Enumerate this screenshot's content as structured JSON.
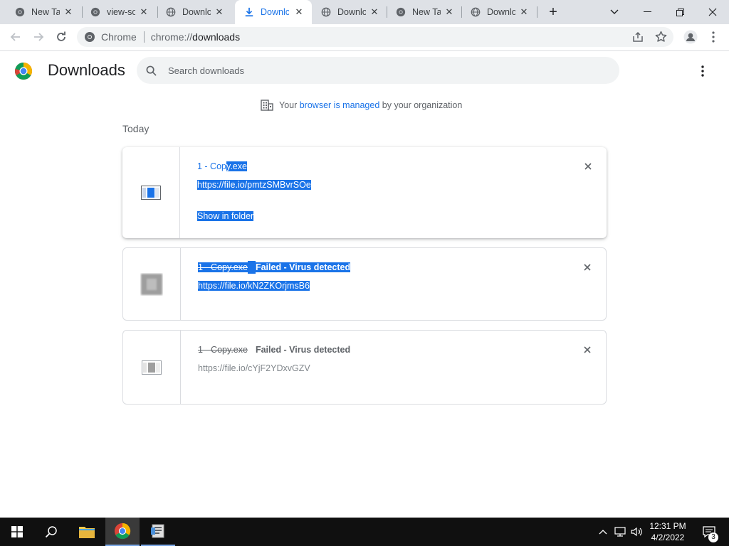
{
  "tabs": [
    {
      "title": "New Tab",
      "icon": "chrome-icon",
      "active": false
    },
    {
      "title": "view-source",
      "icon": "chrome-icon",
      "active": false
    },
    {
      "title": "Downloads",
      "icon": "globe-icon",
      "active": false
    },
    {
      "title": "Downloads",
      "icon": "download-icon",
      "active": true
    },
    {
      "title": "Downloads",
      "icon": "globe-icon",
      "active": false
    },
    {
      "title": "New Tab",
      "icon": "chrome-icon",
      "active": false
    },
    {
      "title": "Downloads",
      "icon": "globe-icon",
      "active": false
    }
  ],
  "omnibox": {
    "chip_label": "Chrome",
    "url_scheme": "chrome://",
    "url_path": "downloads"
  },
  "downloads_page": {
    "title": "Downloads",
    "search_placeholder": "Search downloads",
    "managed_prefix": "Your ",
    "managed_link": "browser is managed",
    "managed_suffix": " by your organization",
    "section_label": "Today"
  },
  "items": [
    {
      "name_a": "1 - Cop",
      "name_b": "y.exe",
      "url": "https://file.io/pmtzSMBvrSOe",
      "action": "Show in folder",
      "status": ""
    },
    {
      "name": "1 - Copy.exe",
      "url": "https://file.io/kN2ZKOrjmsB6",
      "status": "Failed - Virus detected"
    },
    {
      "name": "1 - Copy.exe",
      "url": "https://file.io/cYjF2YDxvGZV",
      "status": "Failed - Virus detected"
    }
  ],
  "taskbar": {
    "time": "12:31 PM",
    "date": "4/2/2022",
    "notification_count": "3"
  },
  "colors": {
    "accent": "#1a73e8",
    "selection": "#1a73e8",
    "tabstrip": "#dee1e6",
    "taskbar": "#101010"
  }
}
